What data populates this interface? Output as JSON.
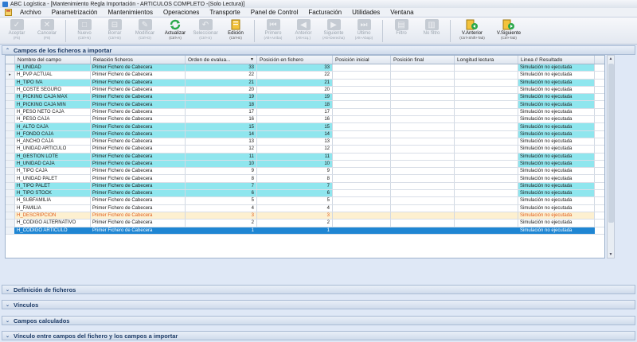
{
  "window": {
    "title": "ABC Logística - [Mantenimiento Regla Importación - ARTICULOS COMPLETO -(Solo Lectura)]"
  },
  "menu": [
    "Archivo",
    "Parametrización",
    "Mantenimientos",
    "Operaciones",
    "Transporte",
    "Panel de Control",
    "Facturación",
    "Utilidades",
    "Ventana"
  ],
  "toolbar": [
    {
      "label": "Aceptar",
      "sub": "(F5)",
      "icon": "check-icon",
      "enabled": false
    },
    {
      "label": "Cancelar",
      "sub": "(F8)",
      "icon": "cancel-icon",
      "enabled": false
    },
    {
      "label": "Nuevo",
      "sub": "(Ctrl+N)",
      "icon": "new-icon",
      "enabled": false
    },
    {
      "label": "Borrar",
      "sub": "(Ctrl+B)",
      "icon": "delete-icon",
      "enabled": false
    },
    {
      "label": "Modificar",
      "sub": "(Ctrl+D)",
      "icon": "edit-icon",
      "enabled": false
    },
    {
      "label": "Actualizar",
      "sub": "(Ctrl+A)",
      "icon": "refresh-icon",
      "enabled": true
    },
    {
      "label": "Seleccionar",
      "sub": "(Ctrl+S)",
      "icon": "select-icon",
      "enabled": false
    },
    {
      "label": "Edición",
      "sub": "(Ctrl+E)",
      "icon": "edition-icon",
      "enabled": true
    },
    {
      "label": "Primero",
      "sub": "(Alt+Arriba)",
      "icon": "first-icon",
      "enabled": false
    },
    {
      "label": "Anterior",
      "sub": "(Alt+Izq.)",
      "icon": "previous-icon",
      "enabled": false
    },
    {
      "label": "Siguiente",
      "sub": "(Alt+Derecha)",
      "icon": "next-icon",
      "enabled": false
    },
    {
      "label": "Último",
      "sub": "(Alt+Abajo)",
      "icon": "last-icon",
      "enabled": false
    },
    {
      "label": "Filtro",
      "sub": "",
      "icon": "filter-icon",
      "enabled": false
    },
    {
      "label": "No filtro",
      "sub": "",
      "icon": "no-filter-icon",
      "enabled": false
    },
    {
      "label": "V.Anterior",
      "sub": "(Ctrl+Shift+Tab)",
      "icon": "prev-window-icon",
      "enabled": true
    },
    {
      "label": "V.Siguiente",
      "sub": "(Ctrl+Tab)",
      "icon": "next-window-icon",
      "enabled": true
    }
  ],
  "panels": {
    "campos": "Campos de los ficheros a importar",
    "definicion": "Definición de ficheros",
    "vinculos": "Vínculos",
    "calculados": "Campos calculados",
    "vinculo_campos": "Vínculo entre campos del fichero y los campos a importar"
  },
  "grid": {
    "columns": [
      "Nombre del campo",
      "Relación ficheros",
      "Orden de evalua...",
      "Posición en fichero",
      "Posición inicial",
      "Posición final",
      "Longitud lectura",
      "Linea // Resultado"
    ],
    "sort_indicator": "▼",
    "rows": [
      {
        "name": "H_UNIDAD",
        "rel": "Primer Fichero de Cabecera",
        "orden": "33",
        "pos": "33",
        "result": "Simulación no ejecutada",
        "style": "cyan",
        "ind": ""
      },
      {
        "name": "H_PVP ACTUAL",
        "rel": "Primer Fichero de Cabecera",
        "orden": "22",
        "pos": "22",
        "result": "Simulación no ejecutada",
        "style": "white",
        "ind": "▸"
      },
      {
        "name": "H_TIPO IVA",
        "rel": "Primer Fichero de Cabecera",
        "orden": "21",
        "pos": "21",
        "result": "Simulación no ejecutada",
        "style": "cyan",
        "ind": ""
      },
      {
        "name": "H_COSTE SEGURO",
        "rel": "Primer Fichero de Cabecera",
        "orden": "20",
        "pos": "20",
        "result": "Simulación no ejecutada",
        "style": "white",
        "ind": ""
      },
      {
        "name": "H_PICKING CAJA MAX",
        "rel": "Primer Fichero de Cabecera",
        "orden": "19",
        "pos": "19",
        "result": "Simulación no ejecutada",
        "style": "cyan",
        "ind": ""
      },
      {
        "name": "H_PICKING CAJA MIN",
        "rel": "Primer Fichero de Cabecera",
        "orden": "18",
        "pos": "18",
        "result": "Simulación no ejecutada",
        "style": "cyan",
        "ind": ""
      },
      {
        "name": "H_PESO NETO CAJA",
        "rel": "Primer Fichero de Cabecera",
        "orden": "17",
        "pos": "17",
        "result": "Simulación no ejecutada",
        "style": "white",
        "ind": ""
      },
      {
        "name": "H_PESO CAJA",
        "rel": "Primer Fichero de Cabecera",
        "orden": "16",
        "pos": "16",
        "result": "Simulación no ejecutada",
        "style": "white",
        "ind": ""
      },
      {
        "name": "H_ALTO CAJA",
        "rel": "Primer Fichero de Cabecera",
        "orden": "15",
        "pos": "15",
        "result": "Simulación no ejecutada",
        "style": "cyan",
        "ind": ""
      },
      {
        "name": "H_FONDO CAJA",
        "rel": "Primer Fichero de Cabecera",
        "orden": "14",
        "pos": "14",
        "result": "Simulación no ejecutada",
        "style": "cyan",
        "ind": ""
      },
      {
        "name": "H_ANCHO CAJA",
        "rel": "Primer Fichero de Cabecera",
        "orden": "13",
        "pos": "13",
        "result": "Simulación no ejecutada",
        "style": "white",
        "ind": ""
      },
      {
        "name": "H_UNIDAD ARTICULO",
        "rel": "Primer Fichero de Cabecera",
        "orden": "12",
        "pos": "12",
        "result": "Simulación no ejecutada",
        "style": "white",
        "ind": ""
      },
      {
        "name": "H_GESTION LOTE",
        "rel": "Primer Fichero de Cabecera",
        "orden": "11",
        "pos": "11",
        "result": "Simulación no ejecutada",
        "style": "cyan",
        "ind": ""
      },
      {
        "name": "H_UNIDAD CAJA",
        "rel": "Primer Fichero de Cabecera",
        "orden": "10",
        "pos": "10",
        "result": "Simulación no ejecutada",
        "style": "cyan",
        "ind": ""
      },
      {
        "name": "H_TIPO CAJA",
        "rel": "Primer Fichero de Cabecera",
        "orden": "9",
        "pos": "9",
        "result": "Simulación no ejecutada",
        "style": "white",
        "ind": ""
      },
      {
        "name": "H_UNIDAD PALET",
        "rel": "Primer Fichero de Cabecera",
        "orden": "8",
        "pos": "8",
        "result": "Simulación no ejecutada",
        "style": "white",
        "ind": ""
      },
      {
        "name": "H_TIPO PALET",
        "rel": "Primer Fichero de Cabecera",
        "orden": "7",
        "pos": "7",
        "result": "Simulación no ejecutada",
        "style": "cyan",
        "ind": ""
      },
      {
        "name": "H_TIPO STOCK",
        "rel": "Primer Fichero de Cabecera",
        "orden": "6",
        "pos": "6",
        "result": "Simulación no ejecutada",
        "style": "cyan",
        "ind": ""
      },
      {
        "name": "H_SUBFAMILIA",
        "rel": "Primer Fichero de Cabecera",
        "orden": "5",
        "pos": "5",
        "result": "Simulación no ejecutada",
        "style": "white",
        "ind": ""
      },
      {
        "name": "H_FAMILIA",
        "rel": "Primer Fichero de Cabecera",
        "orden": "4",
        "pos": "4",
        "result": "Simulación no ejecutada",
        "style": "white",
        "ind": ""
      },
      {
        "name": "H_DESCRIPCION",
        "rel": "Primer Fichero de Cabecera",
        "orden": "3",
        "pos": "3",
        "result": "Simulación no ejecutada",
        "style": "orange",
        "ind": ""
      },
      {
        "name": "H_CODIGO ALTERNATIVO",
        "rel": "Primer Fichero de Cabecera",
        "orden": "2",
        "pos": "2",
        "result": "Simulación no ejecutada",
        "style": "white",
        "ind": ""
      },
      {
        "name": "H_CODIGO ARTICULO",
        "rel": "Primer Fichero de Cabecera",
        "orden": "1",
        "pos": "1",
        "result": "Simulación no ejecutada",
        "style": "selected",
        "ind": ""
      }
    ]
  },
  "colors": {
    "cyan_row": "#8fe6ee",
    "selected_row": "#1f86d3",
    "orange_text": "#e06020",
    "accent": "#2e7bd1"
  }
}
